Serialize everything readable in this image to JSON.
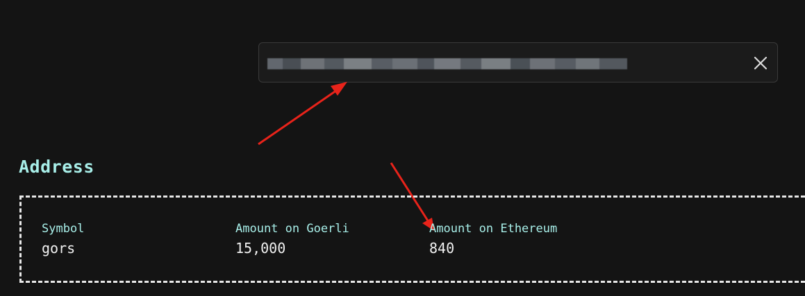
{
  "search": {
    "value_redacted": true
  },
  "section": {
    "title": "Address"
  },
  "table": {
    "columns": [
      {
        "header": "Symbol",
        "value": "gors"
      },
      {
        "header": "Amount on Goerli",
        "value": "15,000"
      },
      {
        "header": "Amount on Ethereum",
        "value": "840"
      }
    ]
  },
  "colors": {
    "background": "#141414",
    "accent": "#a8efe9",
    "annotation_arrow": "#e8231a"
  },
  "icons": {
    "clear": "close-icon"
  }
}
